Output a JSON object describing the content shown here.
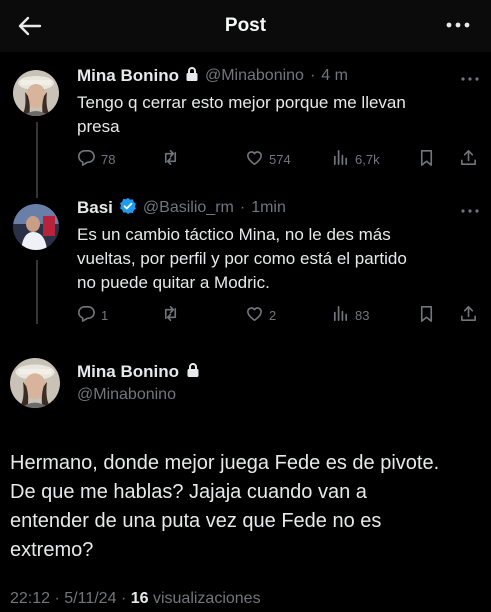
{
  "header": {
    "title": "Post"
  },
  "tweets": [
    {
      "name": "Mina Bonino",
      "handle": "@Minabonino",
      "time": "4 m",
      "text_line1": "Tengo q cerrar esto mejor porque me llevan",
      "text_line2": "presa",
      "replies": "78",
      "reposts": "",
      "likes": "574",
      "views": "6,7k"
    },
    {
      "name": "Basi",
      "handle": "@Basilio_rm",
      "time": "1min",
      "text_line1": "Es un cambio táctico Mina, no le des más",
      "text_line2": "vueltas, por perfil y por como está el partido",
      "text_line3": "no puede quitar a Modric.",
      "replies": "1",
      "reposts": "",
      "likes": "2",
      "views": "83"
    }
  ],
  "main_post": {
    "name": "Mina Bonino",
    "handle": "@Minabonino",
    "line1": "Hermano, donde mejor juega Fede es de pivote.",
    "line2": "De que me hablas? Jajaja cuando van a",
    "line3": "entender de una puta vez que Fede no es",
    "line4": "extremo?",
    "time": "22:12",
    "date": "5/11/24",
    "views_count": "16",
    "views_label": "visualizaciones"
  },
  "colors": {
    "background": "#000000",
    "text": "#e7e9ea",
    "muted": "#71767b",
    "verified": "#1d9bf0"
  },
  "icons": [
    "back-arrow-icon",
    "more-icon",
    "lock-icon",
    "verified-icon",
    "reply-icon",
    "repost-icon",
    "like-icon",
    "views-icon",
    "bookmark-icon",
    "share-icon"
  ]
}
